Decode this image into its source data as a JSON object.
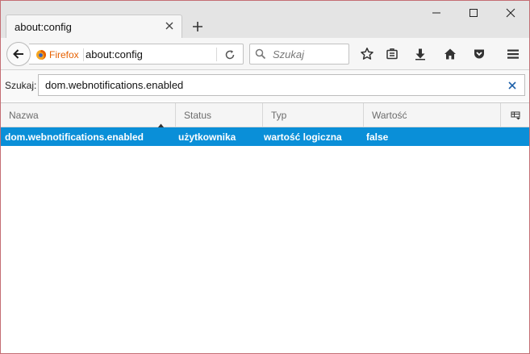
{
  "window": {
    "minimize_label": "–",
    "maximize_label": "☐",
    "close_label": "✕"
  },
  "tab": {
    "title": "about:config",
    "close_glyph": "✕",
    "new_tab_glyph": "+"
  },
  "navbar": {
    "identity_label": "Firefox",
    "url": "about:config",
    "search_placeholder": "Szukaj"
  },
  "config_search": {
    "label": "Szukaj:",
    "value": "dom.webnotifications.enabled"
  },
  "columns": [
    "Nazwa",
    "Status",
    "Typ",
    "Wartość"
  ],
  "rows": [
    {
      "name": "dom.webnotifications.enabled",
      "status": "użytkownika",
      "type": "wartość logiczna",
      "value": "false"
    }
  ],
  "colors": {
    "selection": "#0a8fd8",
    "firefox_orange": "#e66000",
    "window_border": "#c46e74"
  },
  "icons": [
    "back-arrow-icon",
    "firefox-logo-icon",
    "reload-icon",
    "search-icon",
    "star-icon",
    "reading-list-icon",
    "download-icon",
    "home-icon",
    "pocket-icon",
    "menu-icon",
    "clear-icon",
    "column-picker-icon",
    "sort-ascending-icon"
  ]
}
